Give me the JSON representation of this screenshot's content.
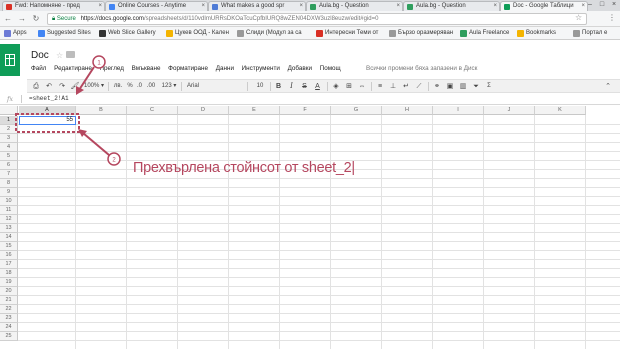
{
  "browser": {
    "tabs": [
      {
        "label": "Fwd: Напомняне - пред",
        "fav_color": "#d93025"
      },
      {
        "label": "Online Courses - Anytime",
        "fav_color": "#4285f4"
      },
      {
        "label": "What makes a good spr",
        "fav_color": "#4e7bd6"
      },
      {
        "label": "Aula.bg - Question",
        "fav_color": "#2f9e5e"
      },
      {
        "label": "Aula.bg - Question",
        "fav_color": "#2f9e5e"
      },
      {
        "label": "Doc - Google Таблици",
        "fav_color": "#0f9d58"
      }
    ],
    "window_controls": [
      "–",
      "□",
      "×"
    ],
    "address": {
      "secure_label": "Secure",
      "url_host": "https://docs.google.com",
      "url_path": "/spreadsheets/d/110vdImURRsDKOaTcuCpfbIURQ8wZEN04DXW3uzl8euzw/edit#gid=0"
    },
    "bookmarks": [
      {
        "label": "Apps",
        "color": "#6d7bd6"
      },
      {
        "label": "Suggested Sites",
        "color": "#4285f4"
      },
      {
        "label": "Web Slice Gallery",
        "color": "#333333"
      },
      {
        "label": "Цукев ООД - Кален",
        "color": "#f4b400"
      },
      {
        "label": "Слиди (Модул за са",
        "color": "#999999"
      },
      {
        "label": "Интересни Теми от",
        "color": "#d93025"
      },
      {
        "label": "Бързо оразмеряван",
        "color": "#999999"
      },
      {
        "label": "Aula Freelance",
        "color": "#2f9e5e"
      },
      {
        "label": "Bookmarks",
        "color": "#f4b400"
      },
      {
        "label": "Портал е",
        "color": "#999999"
      }
    ]
  },
  "doc": {
    "title": "Doc",
    "menus": [
      "Файл",
      "Редактиране",
      "Преглед",
      "Вмъкване",
      "Форматиране",
      "Данни",
      "Инструменти",
      "Добавки",
      "Помощ"
    ],
    "save_note": "Всички промени бяха запазени в Диск",
    "toolbar": {
      "zoom": "100% ▾",
      "currency": "лв.",
      "percent": "%",
      "dec_less": ".0",
      "dec_more": ".00",
      "format_more": "123 ▾",
      "font": "Arial",
      "font_size": "10",
      "bold": "B",
      "italic": "I",
      "strike": "S",
      "text_color": "A"
    },
    "formula": "=sheet_2!A1"
  },
  "grid": {
    "columns": [
      "A",
      "B",
      "C",
      "D",
      "E",
      "F",
      "G",
      "H",
      "I",
      "J",
      "K"
    ],
    "rows": [
      "1",
      "2",
      "3",
      "4",
      "5",
      "6",
      "7",
      "8",
      "9",
      "10",
      "11",
      "12",
      "13",
      "14",
      "15",
      "16",
      "17",
      "18",
      "19",
      "20",
      "21",
      "22",
      "23",
      "24",
      "25"
    ],
    "selected_cell": "A1",
    "a1_value": "55"
  },
  "annotations": {
    "callout_1": "1",
    "callout_2": "2",
    "caption": "Прехвърлена стойнсот от sheet_2|",
    "color": "#b5475f"
  }
}
